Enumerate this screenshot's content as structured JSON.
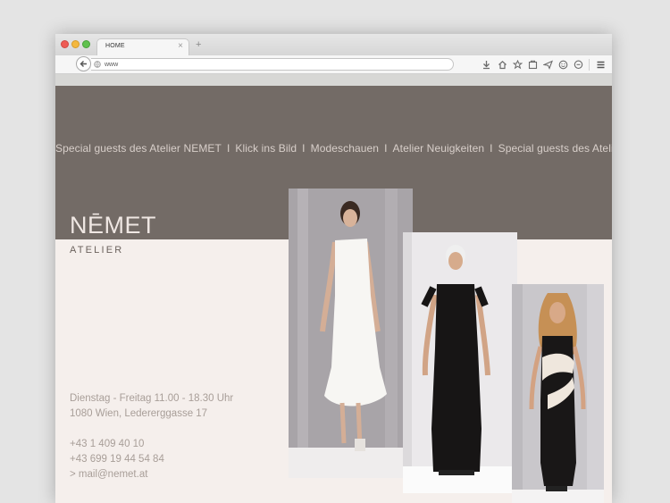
{
  "browser": {
    "tab_title": "HOME",
    "tab_close": "×",
    "new_tab": "+",
    "url": "www"
  },
  "nav": [
    {
      "label": "Special guests des Atelier NEMET"
    },
    {
      "label": "Klick ins Bild"
    },
    {
      "label": "Modeschauen"
    },
    {
      "label": "Atelier Neuigkeiten"
    },
    {
      "label": "Special guests des Atelier"
    }
  ],
  "nav_separator": "I",
  "brand": {
    "logo": "NĒMET",
    "subtitle": "ATELIER"
  },
  "contact": {
    "hours": "Dienstag - Freitag 11.00 - 18.30 Uhr",
    "address": "1080 Wien, Ledererggasse 17",
    "phone1": "+43 1 409 40 10",
    "phone2": "+43 699 19 44 54 84",
    "email": "> mail@nemet.at"
  },
  "colors": {
    "header": "#736b66",
    "page": "#f5efec",
    "text_muted": "#a89e98"
  }
}
